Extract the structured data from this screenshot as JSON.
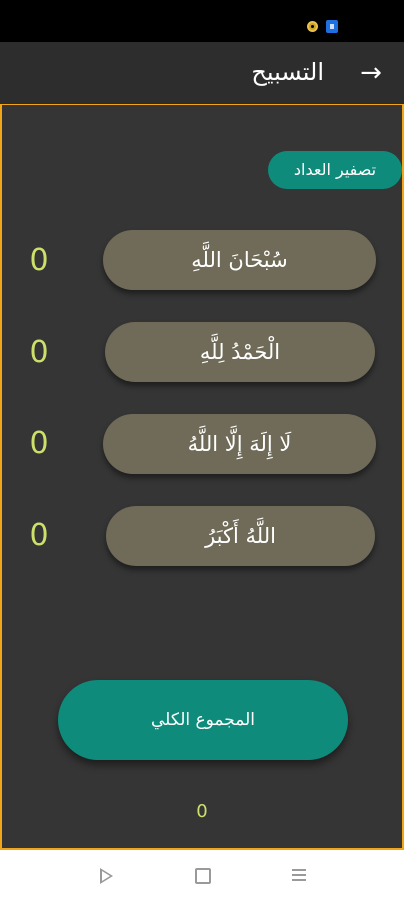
{
  "app_bar": {
    "title": "التسبيح",
    "back_icon": "→"
  },
  "reset_button_label": "تصفير العداد",
  "dhikr": [
    {
      "label": "سُبْحَانَ اللَّهِ",
      "count": "0"
    },
    {
      "label": "الْحَمْدُ لِلَّهِ",
      "count": "0"
    },
    {
      "label": "لَا إِلَهَ إِلَّا اللَّهُ",
      "count": "0"
    },
    {
      "label": "اللَّهُ أَكْبَرُ",
      "count": "0"
    }
  ],
  "total": {
    "label": "المجموع الكلي",
    "count": "0"
  },
  "colors": {
    "accent": "#0f8b7c",
    "dhikr_button": "#6f6b58",
    "count_text": "#cde06a",
    "frame_border": "#f2a516",
    "background": "#353535"
  },
  "status_icons": [
    "notification-circle-icon",
    "blue-app-icon"
  ],
  "nav_icons": [
    "back-triangle-icon",
    "home-square-icon",
    "menu-lines-icon"
  ]
}
